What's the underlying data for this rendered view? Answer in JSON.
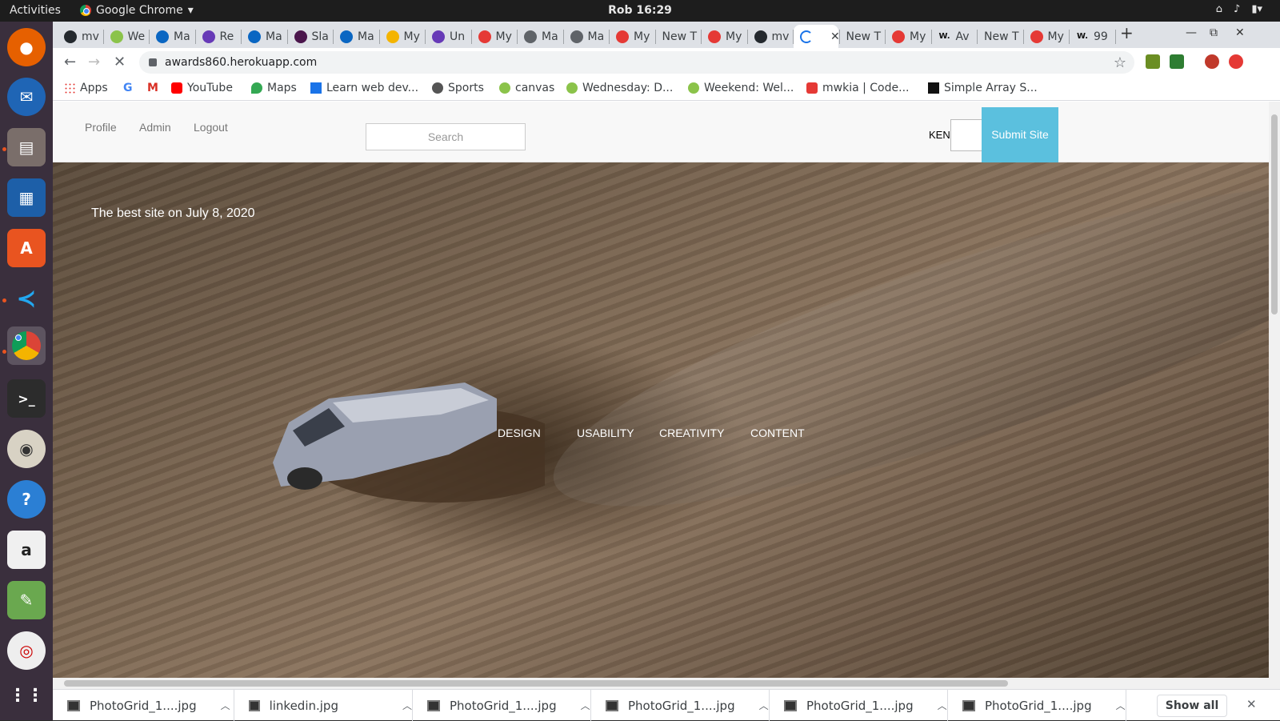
{
  "os": {
    "activities": "Activities",
    "app_name": "Google Chrome",
    "clock": "Rob 16:29"
  },
  "browser": {
    "tabs": [
      {
        "label": "mv",
        "icon": "github-icon"
      },
      {
        "label": "We",
        "icon": "palm-icon"
      },
      {
        "label": "Ma",
        "icon": "linkedin-icon"
      },
      {
        "label": "Re",
        "icon": "forms-icon"
      },
      {
        "label": "Ma",
        "icon": "linkedin-icon"
      },
      {
        "label": "Sla",
        "icon": "slack-icon"
      },
      {
        "label": "Ma",
        "icon": "linkedin-icon"
      },
      {
        "label": "My",
        "icon": "drive-icon"
      },
      {
        "label": "Un",
        "icon": "forms-icon"
      },
      {
        "label": "My",
        "icon": "mw-icon"
      },
      {
        "label": "Ma",
        "icon": "globe-icon"
      },
      {
        "label": "Ma",
        "icon": "globe-icon"
      },
      {
        "label": "My",
        "icon": "mw-icon"
      },
      {
        "label": "New T",
        "icon": ""
      },
      {
        "label": "My",
        "icon": "mw-icon"
      },
      {
        "label": "mv",
        "icon": "github-icon"
      },
      {
        "label": "",
        "icon": "loading-icon"
      },
      {
        "label": "New T",
        "icon": ""
      },
      {
        "label": "My",
        "icon": "mw-icon"
      },
      {
        "label": "Av",
        "icon": "w-icon"
      },
      {
        "label": "New T",
        "icon": ""
      },
      {
        "label": "My",
        "icon": "mw-icon"
      },
      {
        "label": "99",
        "icon": "w-icon"
      }
    ],
    "url": "awards860.herokuapp.com",
    "bookmarks": [
      {
        "label": "Apps"
      },
      {
        "label": ""
      },
      {
        "label": ""
      },
      {
        "label": "YouTube"
      },
      {
        "label": "Maps"
      },
      {
        "label": "Learn web dev..."
      },
      {
        "label": "Sports"
      },
      {
        "label": "canvas"
      },
      {
        "label": "Wednesday: D..."
      },
      {
        "label": "Weekend: Wel..."
      },
      {
        "label": "mwkia | Code..."
      },
      {
        "label": "Simple Array S..."
      }
    ]
  },
  "site": {
    "nav": {
      "profile": "Profile",
      "admin": "Admin",
      "logout": "Logout",
      "search_placeholder": "Search",
      "user": "KEN",
      "submit": "Submit Site"
    },
    "hero": {
      "tagline": "The best site on July 8, 2020",
      "categories": [
        "DESIGN",
        "USABILITY",
        "CREATIVITY",
        "CONTENT"
      ]
    }
  },
  "downloads": {
    "items": [
      "PhotoGrid_1....jpg",
      "linkedin.jpg",
      "PhotoGrid_1....jpg",
      "PhotoGrid_1....jpg",
      "PhotoGrid_1....jpg",
      "PhotoGrid_1....jpg"
    ],
    "show_all": "Show all"
  }
}
